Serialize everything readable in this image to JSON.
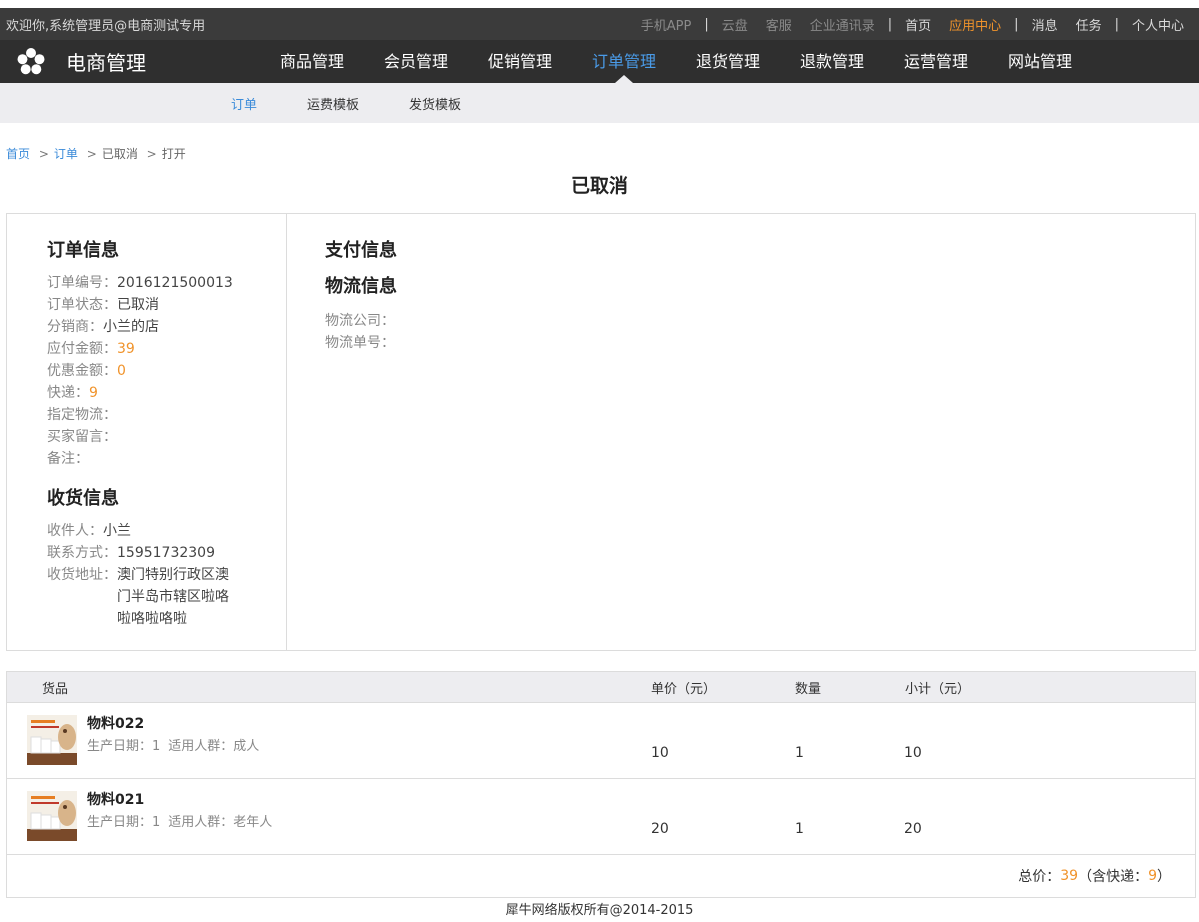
{
  "topbar": {
    "welcome": "欢迎你,系统管理员@电商测试专用",
    "links_dim": [
      "手机APP",
      "云盘",
      "客服",
      "企业通讯录"
    ],
    "home": "首页",
    "app_center": "应用中心",
    "messages": "消息",
    "tasks": "任务",
    "personal": "个人中心",
    "sep": "|"
  },
  "nav": {
    "brand": "电商管理",
    "items": [
      "商品管理",
      "会员管理",
      "促销管理",
      "订单管理",
      "退货管理",
      "退款管理",
      "运营管理",
      "网站管理"
    ],
    "active_index": 3
  },
  "subnav": {
    "items": [
      "订单",
      "运费模板",
      "发货模板"
    ],
    "active_index": 0
  },
  "breadcrumb": {
    "home": "首页",
    "sep1": ">",
    "orders": "订单",
    "sep2": ">",
    "status": "已取消",
    "sep3": ">",
    "current": "打开"
  },
  "page_title": "已取消",
  "order_info": {
    "title": "订单信息",
    "order_no_label": "订单编号：",
    "order_no": "2016121500013",
    "status_label": "订单状态：",
    "status": "已取消",
    "distributor_label": "分销商：",
    "distributor": "小兰的店",
    "payable_label": "应付金额：",
    "payable": "39",
    "discount_label": "优惠金额：",
    "discount": "0",
    "express_label": "快递：",
    "express": "9",
    "logistics_assigned_label": "指定物流：",
    "buyer_message_label": "买家留言：",
    "remark_label": "备注："
  },
  "receiver_info": {
    "title": "收货信息",
    "name_label": "收件人：",
    "name": "小兰",
    "phone_label": "联系方式：",
    "phone": "15951732309",
    "address_label": "收货地址：",
    "address": "澳门特别行政区澳门半岛市辖区啦咯啦咯啦咯啦"
  },
  "payment_info": {
    "title": "支付信息"
  },
  "logistics_info": {
    "title": "物流信息",
    "company_label": "物流公司：",
    "tracking_label": "物流单号："
  },
  "goods": {
    "headers": {
      "goods": "货品",
      "price": "单价（元）",
      "qty": "数量",
      "subtotal": "小计（元）"
    },
    "rows": [
      {
        "name": "物料022",
        "prod_date": "生产日期：1",
        "audience": "适用人群：成人",
        "price": "10",
        "qty": "1",
        "subtotal": "10"
      },
      {
        "name": "物料021",
        "prod_date": "生产日期：1",
        "audience": "适用人群：老年人",
        "price": "20",
        "qty": "1",
        "subtotal": "20"
      }
    ],
    "total_label": "总价：",
    "total": "39",
    "express_prefix": "（含快递：",
    "express": "9",
    "express_suffix": "）"
  },
  "footer": "犀牛网络版权所有@2014-2015",
  "colors": {
    "accent": "#3b8bd9",
    "orange": "#f0932b",
    "nav_bg": "#2f2f2f",
    "top_bg": "#3b3b3b"
  }
}
